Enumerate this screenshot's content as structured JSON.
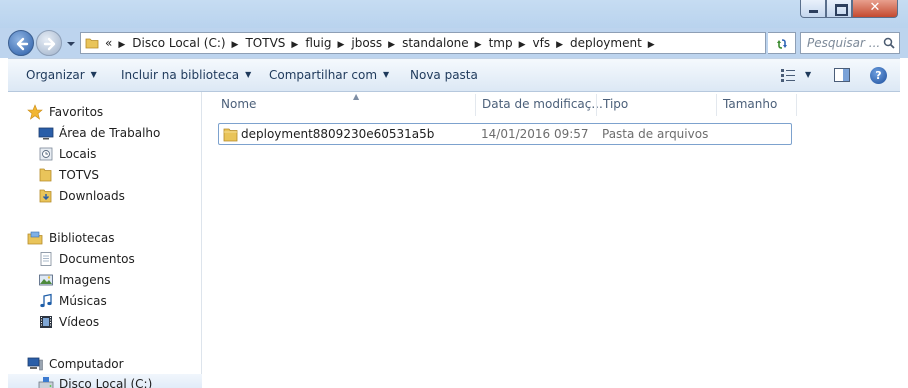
{
  "address": {
    "crumbs": [
      "Disco Local (C:)",
      "TOTVS",
      "fluig",
      "jboss",
      "standalone",
      "tmp",
      "vfs",
      "deployment"
    ],
    "overflow": "«"
  },
  "search": {
    "placeholder": "Pesquisar ..."
  },
  "toolbar": {
    "organize": "Organizar",
    "include_library": "Incluir na biblioteca",
    "share": "Compartilhar com",
    "new_folder": "Nova pasta"
  },
  "navpane": {
    "favorites": {
      "label": "Favoritos",
      "items": [
        {
          "label": "Área de Trabalho",
          "icon": "desktop-icon"
        },
        {
          "label": "Locais",
          "icon": "recent-places-icon"
        },
        {
          "label": "TOTVS",
          "icon": "folder-icon"
        },
        {
          "label": "Downloads",
          "icon": "downloads-icon"
        }
      ]
    },
    "libraries": {
      "label": "Bibliotecas",
      "items": [
        {
          "label": "Documentos",
          "icon": "documents-icon"
        },
        {
          "label": "Imagens",
          "icon": "pictures-icon"
        },
        {
          "label": "Músicas",
          "icon": "music-icon"
        },
        {
          "label": "Vídeos",
          "icon": "videos-icon"
        }
      ]
    },
    "computer": {
      "label": "Computador",
      "items": [
        {
          "label": "Disco Local (C:)",
          "icon": "drive-icon"
        }
      ]
    }
  },
  "columns": [
    "Nome",
    "Data de modificaç...",
    "Tipo",
    "Tamanho"
  ],
  "files": [
    {
      "name": "deployment8809230e60531a5b",
      "modified": "14/01/2016 09:57",
      "type": "Pasta de arquivos",
      "size": ""
    }
  ],
  "colors": {
    "titlebar": "#c6dcf2",
    "selection_border": "#7da2ce",
    "toolbar_text": "#1e395b",
    "folder": "#e9c45a"
  }
}
